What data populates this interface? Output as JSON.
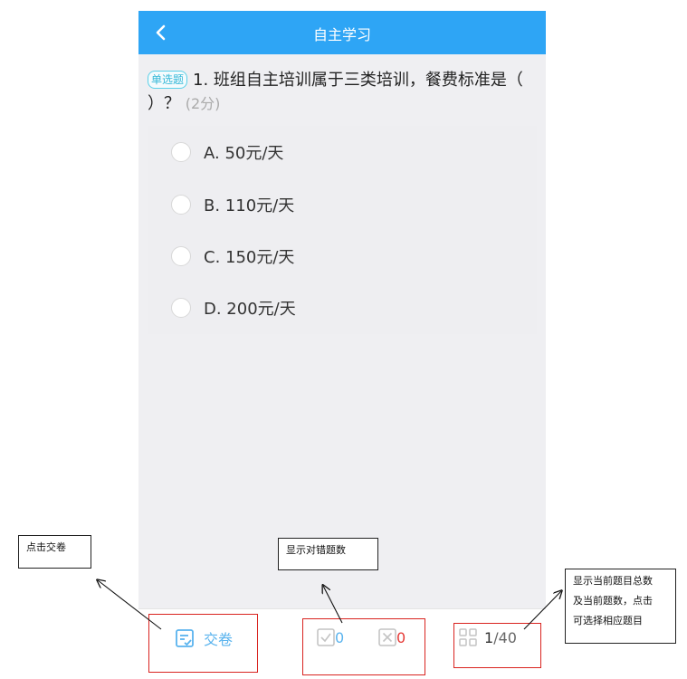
{
  "header": {
    "title": "自主学习",
    "back_icon": "chevron-left-icon"
  },
  "question": {
    "type_badge": "单选题",
    "text": "1.  班组自主培训属于三类培训，餐费标准是（  ）？",
    "score": "(2分)"
  },
  "options": [
    {
      "label": "A. 50元/天"
    },
    {
      "label": "B. 110元/天"
    },
    {
      "label": "C. 150元/天"
    },
    {
      "label": "D. 200元/天"
    }
  ],
  "bottom_bar": {
    "submit_label": "交卷",
    "correct_count": "0",
    "wrong_count": "0",
    "current_page": "1",
    "total_pages": "/40"
  },
  "annotations": {
    "submit_note": "点击交卷",
    "score_note": "显示对错题数",
    "count_note": [
      "显示当前题目总数",
      "及当前题数，点击",
      "可选择相应题目"
    ]
  },
  "colors": {
    "header": "#2ea5f5",
    "accent": "#59b3ee",
    "wrong": "#e53935",
    "highlight_box": "#d9231f"
  }
}
